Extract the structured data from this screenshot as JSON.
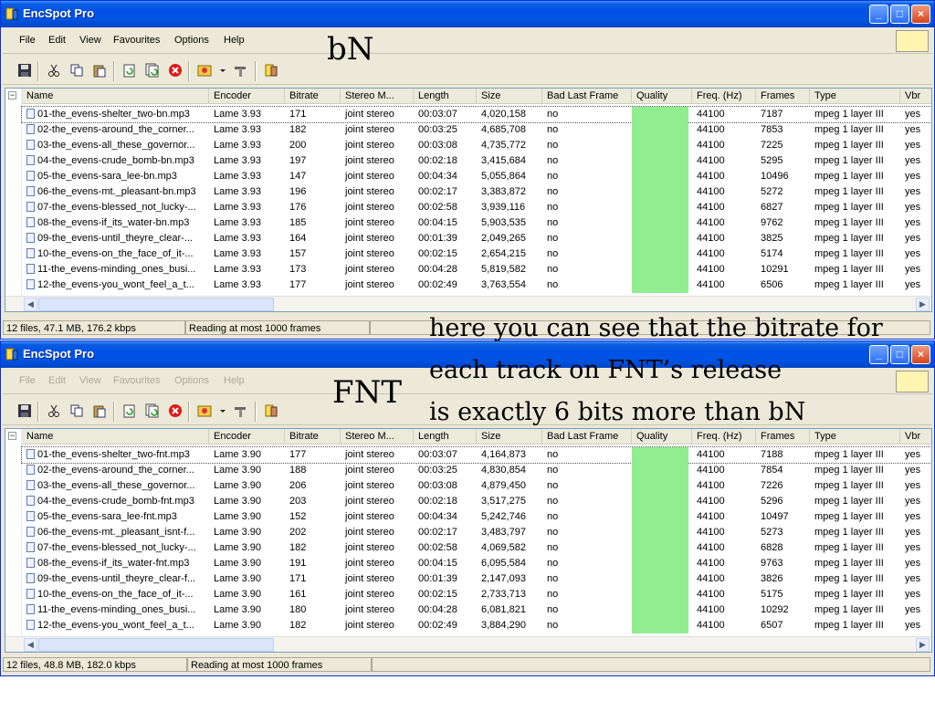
{
  "app_title": "EncSpot Pro",
  "menu": [
    "File",
    "Edit",
    "View",
    "Favourites",
    "Options",
    "Help"
  ],
  "columns": [
    "Name",
    "Encoder",
    "Bitrate",
    "Stereo M...",
    "Length",
    "Size",
    "Bad Last Frame",
    "Quality",
    "Freq. (Hz)",
    "Frames",
    "Type",
    "Vbr"
  ],
  "icons": {
    "toolbar": [
      "save-icon",
      "cut-icon",
      "copy-icon",
      "paste-icon",
      "refresh-icon",
      "refresh-all-icon",
      "stop-icon",
      "favourites-icon",
      "dropdown-arrow-icon",
      "tools-icon",
      "about-icon"
    ]
  },
  "colors": {
    "quality_good": "#90ee90",
    "titlebar": "#0054e3"
  },
  "top": {
    "status": [
      "12 files, 47.1 MB, 176.2 kbps",
      "Reading at most 1000 frames"
    ],
    "rows": [
      [
        "01-the_evens-shelter_two-bn.mp3",
        "Lame 3.93",
        "171",
        "joint stereo",
        "00:03:07",
        "4,020,158",
        "no",
        "",
        "44100",
        "7187",
        "mpeg 1 layer III",
        "yes"
      ],
      [
        "02-the_evens-around_the_corner...",
        "Lame 3.93",
        "182",
        "joint stereo",
        "00:03:25",
        "4,685,708",
        "no",
        "",
        "44100",
        "7853",
        "mpeg 1 layer III",
        "yes"
      ],
      [
        "03-the_evens-all_these_governor...",
        "Lame 3.93",
        "200",
        "joint stereo",
        "00:03:08",
        "4,735,772",
        "no",
        "",
        "44100",
        "7225",
        "mpeg 1 layer III",
        "yes"
      ],
      [
        "04-the_evens-crude_bomb-bn.mp3",
        "Lame 3.93",
        "197",
        "joint stereo",
        "00:02:18",
        "3,415,684",
        "no",
        "",
        "44100",
        "5295",
        "mpeg 1 layer III",
        "yes"
      ],
      [
        "05-the_evens-sara_lee-bn.mp3",
        "Lame 3.93",
        "147",
        "joint stereo",
        "00:04:34",
        "5,055,864",
        "no",
        "",
        "44100",
        "10496",
        "mpeg 1 layer III",
        "yes"
      ],
      [
        "06-the_evens-mt._pleasant-bn.mp3",
        "Lame 3.93",
        "196",
        "joint stereo",
        "00:02:17",
        "3,383,872",
        "no",
        "",
        "44100",
        "5272",
        "mpeg 1 layer III",
        "yes"
      ],
      [
        "07-the_evens-blessed_not_lucky-...",
        "Lame 3.93",
        "176",
        "joint stereo",
        "00:02:58",
        "3,939,116",
        "no",
        "",
        "44100",
        "6827",
        "mpeg 1 layer III",
        "yes"
      ],
      [
        "08-the_evens-if_its_water-bn.mp3",
        "Lame 3.93",
        "185",
        "joint stereo",
        "00:04:15",
        "5,903,535",
        "no",
        "",
        "44100",
        "9762",
        "mpeg 1 layer III",
        "yes"
      ],
      [
        "09-the_evens-until_theyre_clear-...",
        "Lame 3.93",
        "164",
        "joint stereo",
        "00:01:39",
        "2,049,265",
        "no",
        "",
        "44100",
        "3825",
        "mpeg 1 layer III",
        "yes"
      ],
      [
        "10-the_evens-on_the_face_of_it-...",
        "Lame 3.93",
        "157",
        "joint stereo",
        "00:02:15",
        "2,654,215",
        "no",
        "",
        "44100",
        "5174",
        "mpeg 1 layer III",
        "yes"
      ],
      [
        "11-the_evens-minding_ones_busi...",
        "Lame 3.93",
        "173",
        "joint stereo",
        "00:04:28",
        "5,819,582",
        "no",
        "",
        "44100",
        "10291",
        "mpeg 1 layer III",
        "yes"
      ],
      [
        "12-the_evens-you_wont_feel_a_t...",
        "Lame 3.93",
        "177",
        "joint stereo",
        "00:02:49",
        "3,763,554",
        "no",
        "",
        "44100",
        "6506",
        "mpeg 1 layer III",
        "yes"
      ]
    ]
  },
  "bottom": {
    "status": [
      "12 files, 48.8 MB, 182.0 kbps",
      "Reading at most 1000 frames"
    ],
    "rows": [
      [
        "01-the_evens-shelter_two-fnt.mp3",
        "Lame 3.90",
        "177",
        "joint stereo",
        "00:03:07",
        "4,164,873",
        "no",
        "",
        "44100",
        "7188",
        "mpeg 1 layer III",
        "yes"
      ],
      [
        "02-the_evens-around_the_corner...",
        "Lame 3.90",
        "188",
        "joint stereo",
        "00:03:25",
        "4,830,854",
        "no",
        "",
        "44100",
        "7854",
        "mpeg 1 layer III",
        "yes"
      ],
      [
        "03-the_evens-all_these_governor...",
        "Lame 3.90",
        "206",
        "joint stereo",
        "00:03:08",
        "4,879,450",
        "no",
        "",
        "44100",
        "7226",
        "mpeg 1 layer III",
        "yes"
      ],
      [
        "04-the_evens-crude_bomb-fnt.mp3",
        "Lame 3.90",
        "203",
        "joint stereo",
        "00:02:18",
        "3,517,275",
        "no",
        "",
        "44100",
        "5296",
        "mpeg 1 layer III",
        "yes"
      ],
      [
        "05-the_evens-sara_lee-fnt.mp3",
        "Lame 3.90",
        "152",
        "joint stereo",
        "00:04:34",
        "5,242,746",
        "no",
        "",
        "44100",
        "10497",
        "mpeg 1 layer III",
        "yes"
      ],
      [
        "06-the_evens-mt._pleasant_isnt-f...",
        "Lame 3.90",
        "202",
        "joint stereo",
        "00:02:17",
        "3,483,797",
        "no",
        "",
        "44100",
        "5273",
        "mpeg 1 layer III",
        "yes"
      ],
      [
        "07-the_evens-blessed_not_lucky-...",
        "Lame 3.90",
        "182",
        "joint stereo",
        "00:02:58",
        "4,069,582",
        "no",
        "",
        "44100",
        "6828",
        "mpeg 1 layer III",
        "yes"
      ],
      [
        "08-the_evens-if_its_water-fnt.mp3",
        "Lame 3.90",
        "191",
        "joint stereo",
        "00:04:15",
        "6,095,584",
        "no",
        "",
        "44100",
        "9763",
        "mpeg 1 layer III",
        "yes"
      ],
      [
        "09-the_evens-until_theyre_clear-f...",
        "Lame 3.90",
        "171",
        "joint stereo",
        "00:01:39",
        "2,147,093",
        "no",
        "",
        "44100",
        "3826",
        "mpeg 1 layer III",
        "yes"
      ],
      [
        "10-the_evens-on_the_face_of_it-...",
        "Lame 3.90",
        "161",
        "joint stereo",
        "00:02:15",
        "2,733,713",
        "no",
        "",
        "44100",
        "5175",
        "mpeg 1 layer III",
        "yes"
      ],
      [
        "11-the_evens-minding_ones_busi...",
        "Lame 3.90",
        "180",
        "joint stereo",
        "00:04:28",
        "6,081,821",
        "no",
        "",
        "44100",
        "10292",
        "mpeg 1 layer III",
        "yes"
      ],
      [
        "12-the_evens-you_wont_feel_a_t...",
        "Lame 3.90",
        "182",
        "joint stereo",
        "00:02:49",
        "3,884,290",
        "no",
        "",
        "44100",
        "6507",
        "mpeg 1 layer III",
        "yes"
      ]
    ]
  },
  "annotations": {
    "bn_label": "bN",
    "fnt_label": "FNT",
    "caption_lines": [
      "here you can see that the bitrate for",
      "each track on FNT’s release",
      "is exactly 6 bits more than bN"
    ]
  }
}
